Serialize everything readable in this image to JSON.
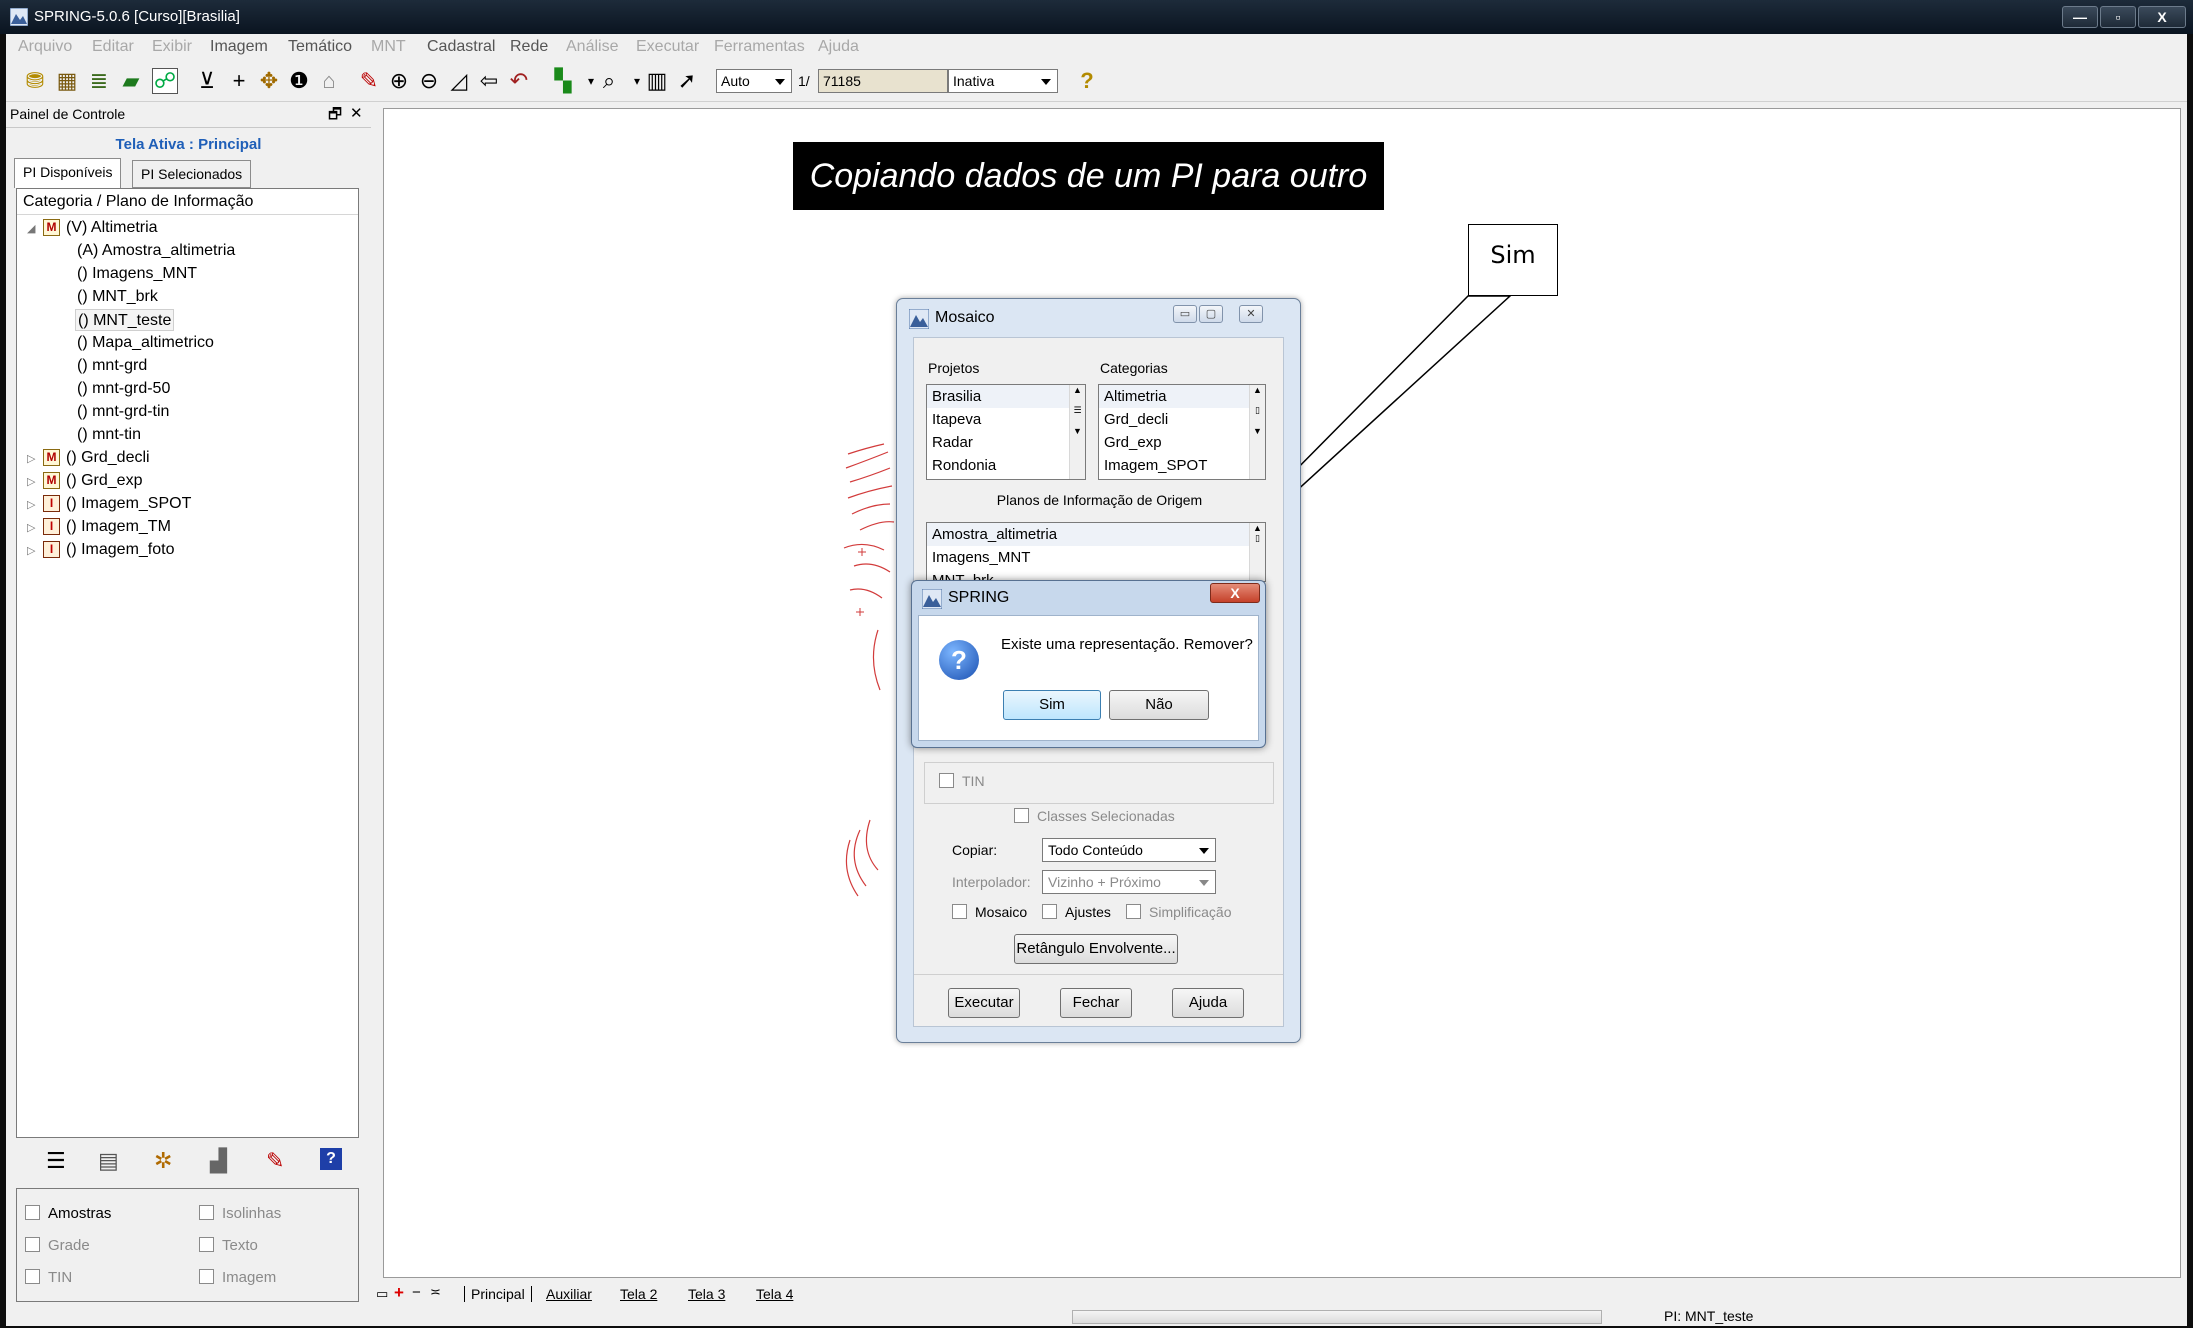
{
  "window": {
    "title": "SPRING-5.0.6 [Curso][Brasilia]",
    "controls": [
      "—",
      "▫",
      "X"
    ]
  },
  "menu": [
    "Arquivo",
    "Editar",
    "Exibir",
    "Imagem",
    "Temático",
    "MNT",
    "Cadastral",
    "Rede",
    "Análise",
    "Executar",
    "Ferramentas",
    "Ajuda"
  ],
  "toolbar": {
    "zoom_mode": "Auto",
    "scale_prefix": "1/",
    "scale_value": "71185",
    "state_value": "Inativa",
    "help": "?"
  },
  "panel": {
    "title": "Painel de Controle",
    "pin": "🗗",
    "close": "✕",
    "active_screen": "Tela Ativa : Principal",
    "tabs": [
      "PI Disponíveis",
      "PI Selecionados"
    ],
    "tree_header": "Categoria / Plano de Informação",
    "tree": [
      {
        "expander": "◢",
        "icon": "M",
        "label": "(V) Altimetria"
      },
      {
        "label": "(A) Amostra_altimetria"
      },
      {
        "label": "() Imagens_MNT"
      },
      {
        "label": "() MNT_brk"
      },
      {
        "label": "() MNT_teste"
      },
      {
        "label": "() Mapa_altimetrico"
      },
      {
        "label": "() mnt-grd"
      },
      {
        "label": "() mnt-grd-50"
      },
      {
        "label": "() mnt-grd-tin"
      },
      {
        "label": "() mnt-tin"
      },
      {
        "expander": "▷",
        "icon": "M",
        "label": "() Grd_decli"
      },
      {
        "expander": "▷",
        "icon": "M",
        "label": "() Grd_exp"
      },
      {
        "expander": "▷",
        "icon": "I",
        "label": "() Imagem_SPOT"
      },
      {
        "expander": "▷",
        "icon": "I",
        "label": "() Imagem_TM"
      },
      {
        "expander": "▷",
        "icon": "I",
        "label": "() Imagem_foto"
      }
    ],
    "checks": [
      {
        "label": "Amostras"
      },
      {
        "label": "Isolinhas"
      },
      {
        "label": "Grade"
      },
      {
        "label": "Texto"
      },
      {
        "label": "TIN"
      },
      {
        "label": "Imagem"
      }
    ]
  },
  "banner": "Copiando dados de um PI para outro",
  "callout": "Sim",
  "screen_tabs": [
    "Principal",
    "Auxiliar",
    "Tela 2",
    "Tela 3",
    "Tela 4"
  ],
  "status": {
    "pi": "PI: MNT_teste"
  },
  "mosaico": {
    "title": "Mosaico",
    "projetos_label": "Projetos",
    "categorias_label": "Categorias",
    "projetos": [
      "Brasilia",
      "Itapeva",
      "Radar",
      "Rondonia"
    ],
    "categorias": [
      "Altimetria",
      "Grd_decli",
      "Grd_exp",
      "Imagem_SPOT"
    ],
    "origem_label": "Planos de Informação de Origem",
    "origem": [
      "Amostra_altimetria",
      "Imagens_MNT",
      "MNT_brk"
    ],
    "tin_label": "TIN",
    "classes_label": "Classes Selecionadas",
    "copiar_label": "Copiar:",
    "copiar_value": "Todo Conteúdo",
    "interp_label": "Interpolador:",
    "interp_value": "Vizinho + Próximo",
    "mosaico_chk": "Mosaico",
    "ajustes_chk": "Ajustes",
    "simpl_chk": "Simplificação",
    "retangulo_btn": "Retângulo Envolvente...",
    "executar_btn": "Executar",
    "fechar_btn": "Fechar",
    "ajuda_btn": "Ajuda"
  },
  "spring_dialog": {
    "title": "SPRING",
    "close": "X",
    "message": "Existe uma representação. Remover?",
    "yes": "Sim",
    "no": "Não"
  }
}
